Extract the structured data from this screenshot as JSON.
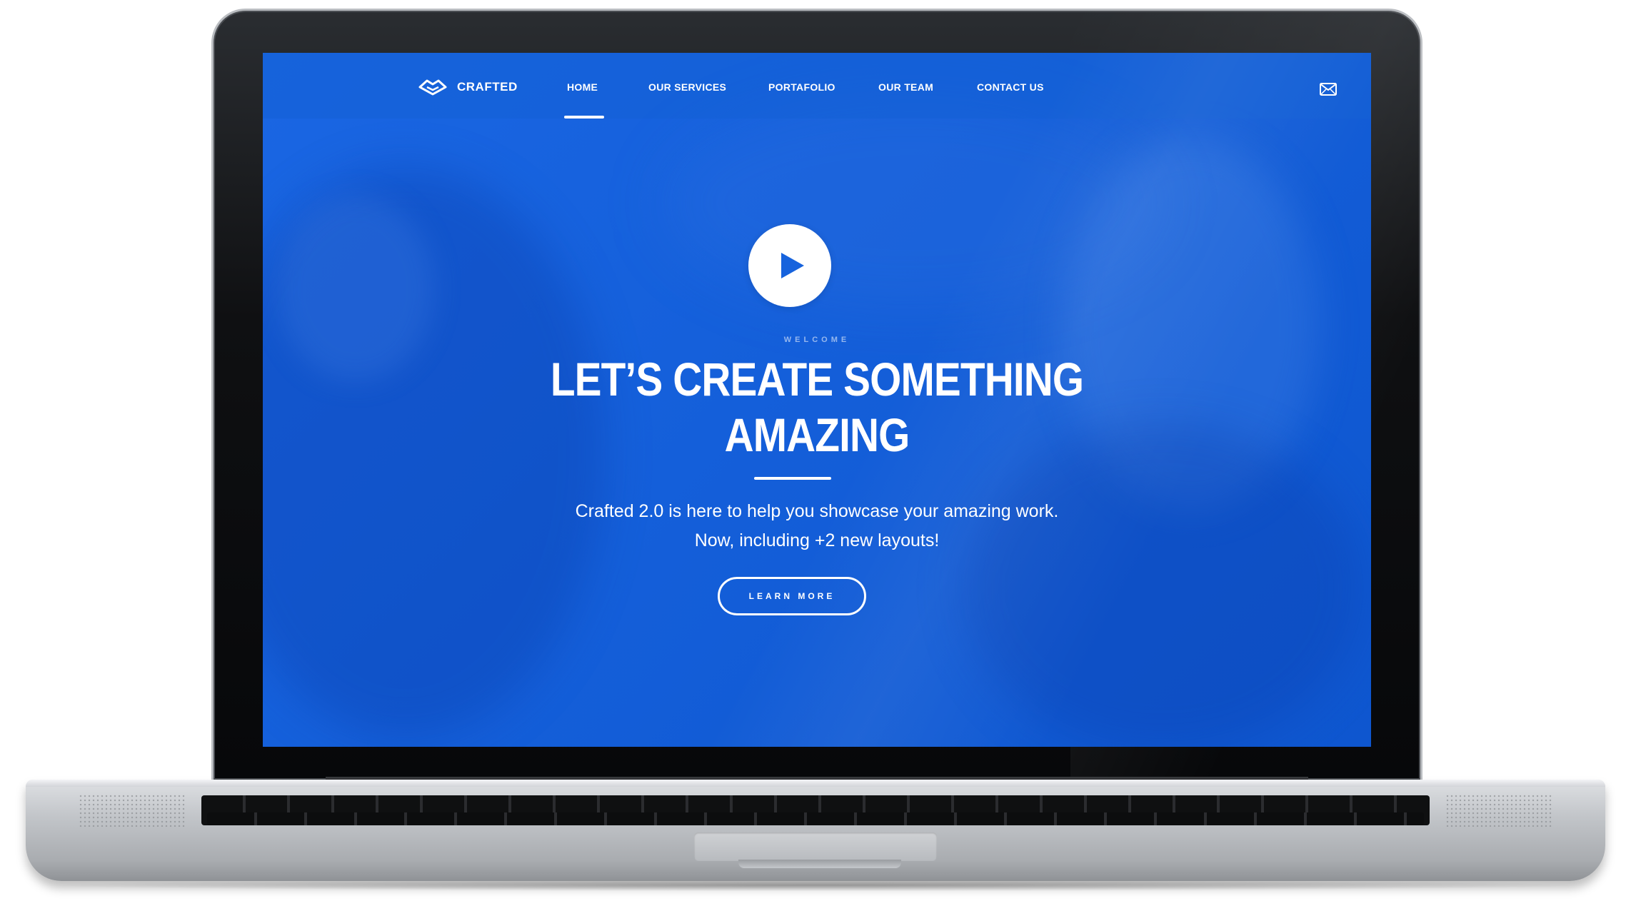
{
  "site": {
    "brand": "CRAFTED",
    "colors": {
      "primary_blue": "#1763dd",
      "text": "#ffffff"
    }
  },
  "nav": {
    "items": [
      {
        "label": "HOME",
        "active": true
      },
      {
        "label": "OUR SERVICES",
        "active": false
      },
      {
        "label": "PORTAFOLIO",
        "active": false
      },
      {
        "label": "OUR TEAM",
        "active": false
      },
      {
        "label": "CONTACT US",
        "active": false
      }
    ],
    "mail_icon": "envelope-icon"
  },
  "hero": {
    "play_icon": "play-icon",
    "eyebrow": "WELCOME",
    "headline_line1": "LET’S CREATE SOMETHING",
    "headline_line2": "AMAZING",
    "subtext_line1": "Crafted 2.0 is here to help you showcase your amazing work.",
    "subtext_line2": "Now, including +2 new layouts!",
    "cta_label": "LEARN MORE"
  }
}
